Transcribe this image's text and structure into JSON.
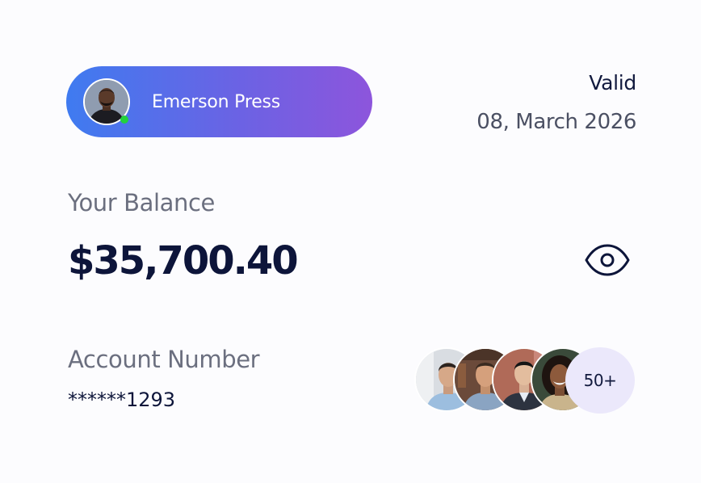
{
  "user": {
    "name": "Emerson Press",
    "status": "online",
    "avatar_icon": "user-avatar"
  },
  "validity": {
    "label": "Valid",
    "date": "08, March 2026"
  },
  "balance": {
    "label": "Your Balance",
    "value": "$35,700.40",
    "toggle_icon": "eye-icon"
  },
  "account": {
    "label": "Account Number",
    "number": "******1293"
  },
  "members": {
    "count_label": "50+",
    "avatars": [
      "member-1",
      "member-2",
      "member-3",
      "member-4"
    ]
  },
  "colors": {
    "pill_gradient_start": "#3f7bf0",
    "pill_gradient_end": "#8d55dc",
    "online": "#22d13d",
    "primary_text": "#0d153a",
    "badge_bg": "#ebe8fb"
  }
}
